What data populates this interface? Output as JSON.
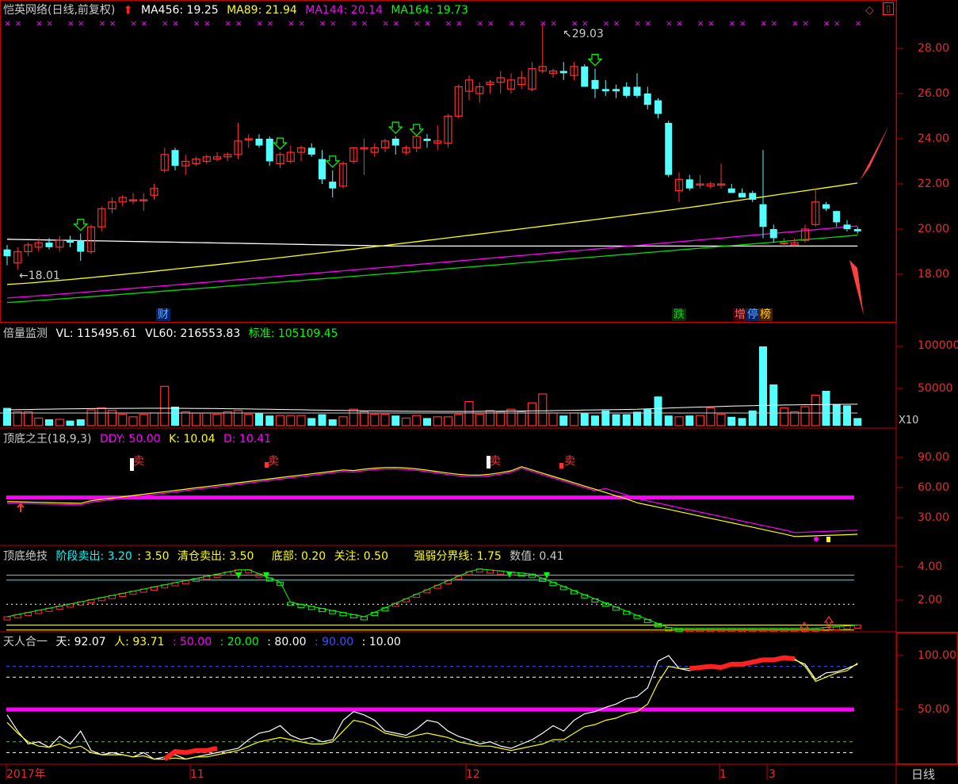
{
  "panel_main": {
    "title": "恺英网络(日线,前复权)",
    "ma": [
      {
        "label": "MA456: 19.25",
        "color": "#ffffff"
      },
      {
        "label": "MA89: 21.94",
        "color": "#ffff00"
      },
      {
        "label": "MA144: 20.14",
        "color": "#ff00ff"
      },
      {
        "label": "MA164: 19.73",
        "color": "#00ff00"
      }
    ],
    "high_label": "29.03",
    "low_label": "18.01",
    "y_ticks": [
      "28.00",
      "26.00",
      "24.00",
      "22.00",
      "20.00",
      "18.00"
    ],
    "events": [
      {
        "text": "财",
        "color": "#66aaff"
      },
      {
        "text": "跌",
        "color": "#00dd00"
      },
      {
        "text": "增",
        "color": "#ff6666"
      },
      {
        "text": "停",
        "color": "#66aaff"
      },
      {
        "text": "榜",
        "color": "#ffcc00"
      }
    ]
  },
  "panel_vol": {
    "title": "倍量监测",
    "items": [
      {
        "label": "VL: 115495.61",
        "color": "#ffffff"
      },
      {
        "label": "VL60: 216553.83",
        "color": "#ffffff"
      },
      {
        "label": "标准: 105109.45",
        "color": "#00ff00"
      }
    ],
    "y_ticks": [
      "100000",
      "50000"
    ],
    "unit": "X10"
  },
  "panel_kd": {
    "title": "顶底之王(18,9,3)",
    "items": [
      {
        "label": "DDY: 50.00",
        "color": "#ff00ff"
      },
      {
        "label": "K: 10.04",
        "color": "#ffff00"
      },
      {
        "label": "D: 10.41",
        "color": "#ff00ff"
      }
    ],
    "y_ticks": [
      "90.00",
      "60.00",
      "30.00"
    ],
    "sell": "卖"
  },
  "panel_jj": {
    "title": "顶底绝技",
    "items": [
      {
        "label": "阶段卖出: 3.20",
        "color": "#00ffff"
      },
      {
        "label": ": 3.50",
        "color": "#ffff00"
      },
      {
        "label": "清仓卖出: 3.50",
        "color": "#ffff00"
      },
      {
        "label": "底部: 0.20",
        "color": "#ffff00"
      },
      {
        "label": "关注: 0.50",
        "color": "#ffff00"
      },
      {
        "label": "强弱分界线: 1.75",
        "color": "#ffff00"
      },
      {
        "label": "数值: 0.41",
        "color": "#cccccc"
      }
    ],
    "y_ticks": [
      "4.00",
      "2.00"
    ]
  },
  "panel_tr": {
    "title": "天人合一",
    "items": [
      {
        "label": "天: 92.07",
        "color": "#ffffff"
      },
      {
        "label": "人: 93.71",
        "color": "#ffff00"
      },
      {
        "label": ": 50.00",
        "color": "#ff00ff"
      },
      {
        "label": ": 20.00",
        "color": "#00ff00"
      },
      {
        "label": ": 80.00",
        "color": "#ffffff"
      },
      {
        "label": ": 90.00",
        "color": "#3355ff"
      },
      {
        "label": ": 10.00",
        "color": "#ffffff"
      }
    ],
    "y_ticks": [
      "100.00",
      "50.00"
    ]
  },
  "x_axis": {
    "labels": [
      "2017年",
      "11",
      "12",
      "1",
      "3"
    ],
    "period": "日线"
  },
  "chart_data": {
    "type": "candlestick",
    "ohlc": [
      [
        19.1,
        19.3,
        18.4,
        18.8
      ],
      [
        18.5,
        19.2,
        18.2,
        19.0
      ],
      [
        19.0,
        19.4,
        18.8,
        19.3
      ],
      [
        19.2,
        19.6,
        19.0,
        19.4
      ],
      [
        19.4,
        19.6,
        19.1,
        19.2
      ],
      [
        19.2,
        19.7,
        19.0,
        19.5
      ],
      [
        19.5,
        19.7,
        19.2,
        19.4
      ],
      [
        19.5,
        19.8,
        18.6,
        19.0
      ],
      [
        19.0,
        20.2,
        18.9,
        20.1
      ],
      [
        20.1,
        21.0,
        19.9,
        20.9
      ],
      [
        20.9,
        21.4,
        20.7,
        21.2
      ],
      [
        21.2,
        21.5,
        21.0,
        21.4
      ],
      [
        21.3,
        21.6,
        21.1,
        21.3
      ],
      [
        21.3,
        21.6,
        20.8,
        21.3
      ],
      [
        21.5,
        22.0,
        21.3,
        21.8
      ],
      [
        22.6,
        23.6,
        22.5,
        23.3
      ],
      [
        23.5,
        23.6,
        22.6,
        22.8
      ],
      [
        22.8,
        23.3,
        22.4,
        23.0
      ],
      [
        22.9,
        23.2,
        22.8,
        23.1
      ],
      [
        23.0,
        23.3,
        22.9,
        23.2
      ],
      [
        23.1,
        23.4,
        23.0,
        23.2
      ],
      [
        23.2,
        23.4,
        23.0,
        23.3
      ],
      [
        23.3,
        24.7,
        23.1,
        23.9
      ],
      [
        24.0,
        24.2,
        23.6,
        24.0
      ],
      [
        24.0,
        24.2,
        23.6,
        23.7
      ],
      [
        24.0,
        24.1,
        22.8,
        23.0
      ],
      [
        22.9,
        23.4,
        22.7,
        23.3
      ],
      [
        23.0,
        23.7,
        22.9,
        23.4
      ],
      [
        23.4,
        23.7,
        23.0,
        23.6
      ],
      [
        23.6,
        23.8,
        23.2,
        23.3
      ],
      [
        23.1,
        23.5,
        22.0,
        22.2
      ],
      [
        22.1,
        22.6,
        21.4,
        21.8
      ],
      [
        21.9,
        23.0,
        21.8,
        22.9
      ],
      [
        23.0,
        23.6,
        22.9,
        23.6
      ],
      [
        23.6,
        24.0,
        22.4,
        23.6
      ],
      [
        23.4,
        23.8,
        23.2,
        23.6
      ],
      [
        23.6,
        24.0,
        23.4,
        23.9
      ],
      [
        24.0,
        24.1,
        23.3,
        23.7
      ],
      [
        23.4,
        23.7,
        23.3,
        23.6
      ],
      [
        23.6,
        24.0,
        23.4,
        24.1
      ],
      [
        24.0,
        24.2,
        23.6,
        23.9
      ],
      [
        23.8,
        24.6,
        23.5,
        23.9
      ],
      [
        23.8,
        25.1,
        23.6,
        25.0
      ],
      [
        25.0,
        26.4,
        24.9,
        26.3
      ],
      [
        26.1,
        26.8,
        25.7,
        26.6
      ],
      [
        26.0,
        26.5,
        25.6,
        26.3
      ],
      [
        26.4,
        26.6,
        26.0,
        26.5
      ],
      [
        26.5,
        27.0,
        26.0,
        26.7
      ],
      [
        26.2,
        26.9,
        26.0,
        26.6
      ],
      [
        26.4,
        27.0,
        26.2,
        26.7
      ],
      [
        26.2,
        27.4,
        26.1,
        27.1
      ],
      [
        27.0,
        29.03,
        26.9,
        27.2
      ],
      [
        26.9,
        27.1,
        26.7,
        27.0
      ],
      [
        27.0,
        27.4,
        26.6,
        26.9
      ],
      [
        26.8,
        27.4,
        26.6,
        27.2
      ],
      [
        27.2,
        27.3,
        26.3,
        26.3
      ],
      [
        26.6,
        27.1,
        25.8,
        26.2
      ],
      [
        26.2,
        26.6,
        25.9,
        26.1
      ],
      [
        26.2,
        26.4,
        25.8,
        26.1
      ],
      [
        26.3,
        26.5,
        25.8,
        25.9
      ],
      [
        26.3,
        26.9,
        25.8,
        25.9
      ],
      [
        26.0,
        26.3,
        25.3,
        25.5
      ],
      [
        25.7,
        25.8,
        24.9,
        25.1
      ],
      [
        24.7,
        24.8,
        22.3,
        22.4
      ],
      [
        21.7,
        22.5,
        21.2,
        22.2
      ],
      [
        22.2,
        22.4,
        21.7,
        21.8
      ],
      [
        22.0,
        22.4,
        21.8,
        22.0
      ],
      [
        21.9,
        22.1,
        21.8,
        22.0
      ],
      [
        22.0,
        22.9,
        21.8,
        22.0
      ],
      [
        21.8,
        22.0,
        21.6,
        21.6
      ],
      [
        21.6,
        21.8,
        21.4,
        21.4
      ],
      [
        21.6,
        21.7,
        21.2,
        21.3
      ],
      [
        21.1,
        23.5,
        19.6,
        20.1
      ],
      [
        20.0,
        20.2,
        19.4,
        19.6
      ],
      [
        19.4,
        19.6,
        19.2,
        19.4
      ],
      [
        19.3,
        19.6,
        19.2,
        19.4
      ],
      [
        19.5,
        20.2,
        19.4,
        20.0
      ],
      [
        20.2,
        21.8,
        20.1,
        21.2
      ],
      [
        21.1,
        21.2,
        20.8,
        20.9
      ],
      [
        20.8,
        20.8,
        20.1,
        20.3
      ],
      [
        20.2,
        20.4,
        19.9,
        20.0
      ],
      [
        20.0,
        20.1,
        19.8,
        19.9
      ]
    ],
    "ylim": [
      17.3,
      29.3
    ],
    "volume": {
      "ylim": [
        0,
        115000
      ],
      "unit": "X10"
    },
    "kd": {
      "ylim": [
        0,
        100
      ]
    },
    "jj": {
      "ylim": [
        0,
        5
      ]
    },
    "tr": {
      "ylim": [
        0,
        115
      ]
    }
  }
}
